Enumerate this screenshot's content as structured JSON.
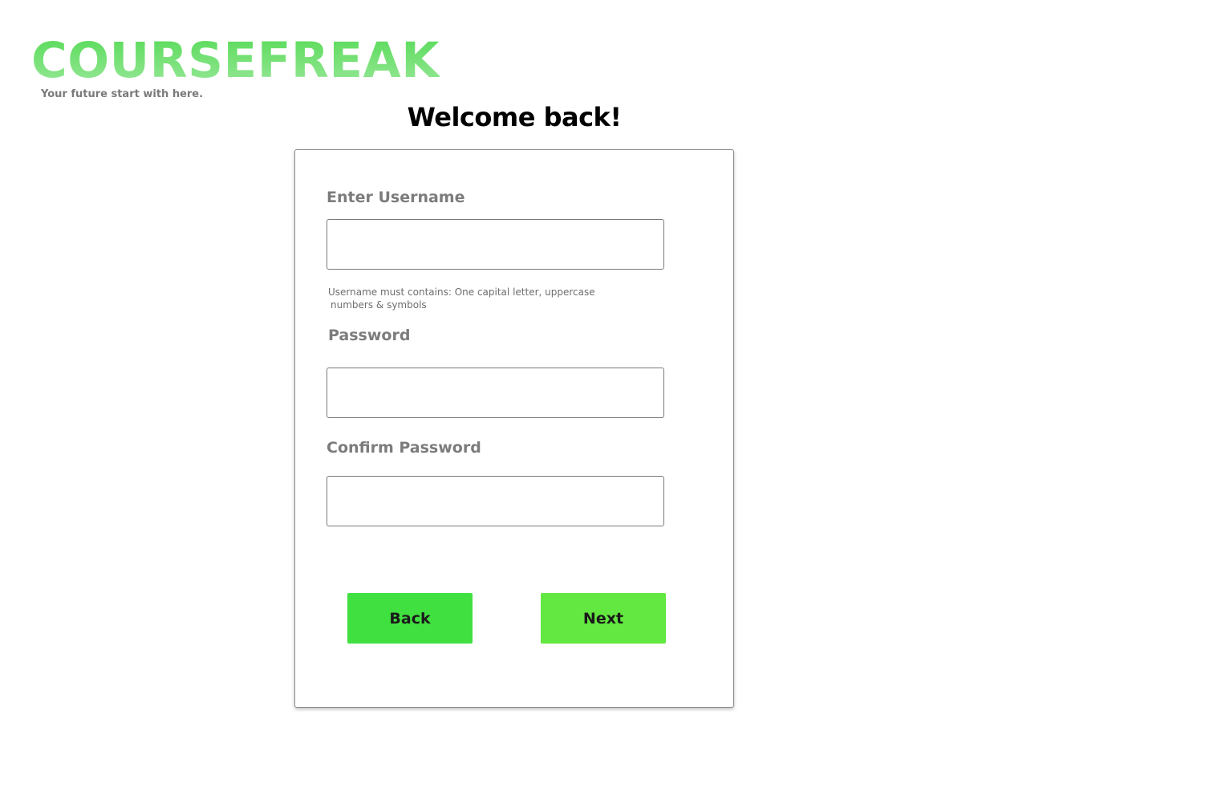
{
  "brand": {
    "logo_text": "COURSEFREAK",
    "tagline": "Your future start with here."
  },
  "page": {
    "title": "Welcome back!"
  },
  "form": {
    "username": {
      "label": "Enter Username",
      "value": "",
      "hint_line1": "Username must contains: One capital letter, uppercase",
      "hint_line2": "numbers & symbols"
    },
    "password": {
      "label": "Password",
      "value": ""
    },
    "confirm_password": {
      "label": "Confirm Password",
      "value": ""
    },
    "back_label": "Back",
    "next_label": "Next"
  },
  "colors": {
    "logo_gradient_top": "#56da56",
    "logo_gradient_bottom": "#9ae89a",
    "back_button": "#41e041",
    "next_button": "#62e840",
    "label_text": "#7c7c7c"
  }
}
